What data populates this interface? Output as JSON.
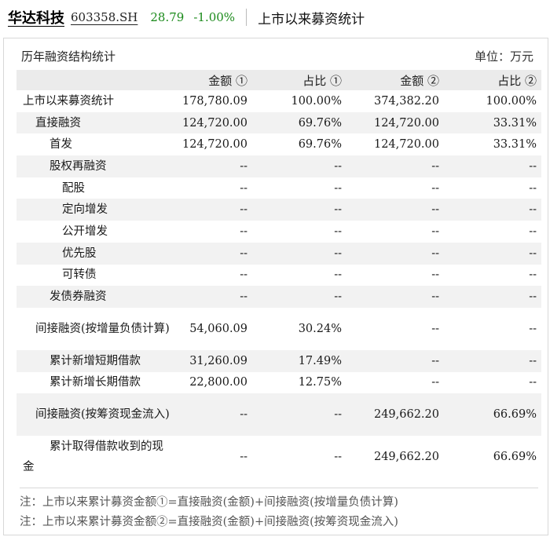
{
  "header": {
    "name": "华达科技",
    "code": "603358.SH",
    "price": "28.79",
    "change": "-1.00%",
    "title": "上市以来募资统计"
  },
  "panel": {
    "title": "历年融资结构统计",
    "unit": "单位：万元"
  },
  "table": {
    "columns": [
      "",
      "金额 ①",
      "占比 ①",
      "金额 ②",
      "占比 ②"
    ],
    "rows": [
      {
        "label": "上市以来募资统计",
        "v": [
          "178,780.09",
          "100.00%",
          "374,382.20",
          "100.00%"
        ]
      },
      {
        "label": "直接融资",
        "v": [
          "124,720.00",
          "69.76%",
          "124,720.00",
          "33.31%"
        ]
      },
      {
        "label": "首发",
        "v": [
          "124,720.00",
          "69.76%",
          "124,720.00",
          "33.31%"
        ]
      },
      {
        "label": "股权再融资",
        "v": [
          "--",
          "--",
          "--",
          "--"
        ]
      },
      {
        "label": "配股",
        "v": [
          "--",
          "--",
          "--",
          "--"
        ]
      },
      {
        "label": "定向增发",
        "v": [
          "--",
          "--",
          "--",
          "--"
        ]
      },
      {
        "label": "公开增发",
        "v": [
          "--",
          "--",
          "--",
          "--"
        ]
      },
      {
        "label": "优先股",
        "v": [
          "--",
          "--",
          "--",
          "--"
        ]
      },
      {
        "label": "可转债",
        "v": [
          "--",
          "--",
          "--",
          "--"
        ]
      },
      {
        "label": "发债券融资",
        "v": [
          "--",
          "--",
          "--",
          "--"
        ]
      },
      {
        "label": "间接融资(按增量负债计算)",
        "v": [
          "54,060.09",
          "30.24%",
          "--",
          "--"
        ]
      },
      {
        "label": "累计新增短期借款",
        "v": [
          "31,260.09",
          "17.49%",
          "--",
          "--"
        ]
      },
      {
        "label": "累计新增长期借款",
        "v": [
          "22,800.00",
          "12.75%",
          "--",
          "--"
        ]
      },
      {
        "label": "间接融资(按筹资现金流入)",
        "v": [
          "--",
          "--",
          "249,662.20",
          "66.69%"
        ]
      },
      {
        "label": "累计取得借款收到的现金",
        "v": [
          "--",
          "--",
          "249,662.20",
          "66.69%"
        ]
      }
    ]
  },
  "notes": [
    "注：上市以来累计募资金额①=直接融资(金额)+间接融资(按增量负债计算)",
    "注：上市以来累计募资金额②=直接融资(金额)+间接融资(按筹资现金流入)"
  ]
}
